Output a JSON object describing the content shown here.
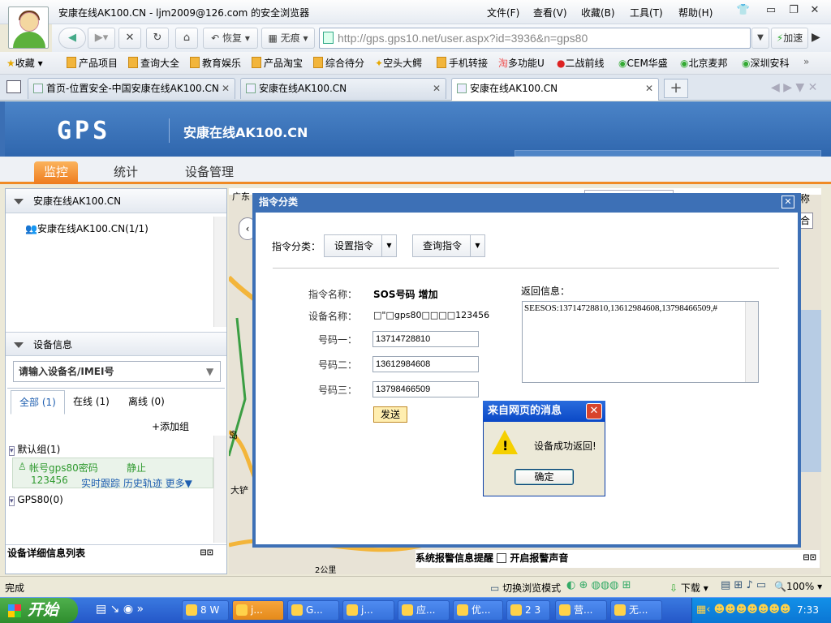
{
  "window": {
    "title": "安康在线AK100.CN - ljm2009@126.com 的安全浏览器",
    "menu": [
      "文件(F)",
      "查看(V)",
      "收藏(B)",
      "工具(T)",
      "帮助(H)"
    ]
  },
  "nav": {
    "restore_label": "恢复",
    "adblock_label": "无痕",
    "url": "http://gps.gps10.net/user.aspx?id=3936&n=gps80",
    "speed_label": "加速"
  },
  "favorites": [
    "收藏",
    "产品项目",
    "查询大全",
    "教育娱乐",
    "产品淘宝",
    "综合待分",
    "空头大鳄",
    "手机转接",
    "多功能U",
    "二战前线",
    "CEM华盛",
    "北京麦邦",
    "深圳安科"
  ],
  "tabs": [
    {
      "label": "首页-位置安全-中国安康在线AK100.CN"
    },
    {
      "label": "安康在线AK100.CN"
    },
    {
      "label": "安康在线AK100.CN"
    }
  ],
  "app": {
    "logo": "GPS",
    "site_name": "安康在线AK100.CN",
    "nav": [
      "监控",
      "统计",
      "设备管理"
    ]
  },
  "left": {
    "tree_header": "安康在线AK100.CN",
    "tree_item": "安康在线AK100.CN(1/1)",
    "device_header": "设备信息",
    "search_placeholder": "请输入设备名/IMEI号",
    "filters": [
      "全部 (1)",
      "在线 (1)",
      "离线 (0)"
    ],
    "add_group": "+添加组",
    "group_default": "默认组(1)",
    "device_line1": "帐号gps80密码",
    "device_status": "静止",
    "device_line2": "123456",
    "device_links": "实时跟踪 历史轨迹 更多▼",
    "group_gps80": "GPS80(0)",
    "detail_list": "设备详细信息列表"
  },
  "map": {
    "top_text": "广东",
    "right_label": "称",
    "right_box": "合",
    "left_label": "岛",
    "bottom_label": "大铲",
    "scale": "2公里",
    "alarm_info": "系统报警信息提醒",
    "alarm_sound": "开启报警声音"
  },
  "dialog": {
    "title": "指令分类",
    "category_label": "指令分类：",
    "set_cmd": "设置指令",
    "query_cmd": "查询指令",
    "cmd_name_label": "指令名称：",
    "cmd_name": "SOS号码 增加",
    "device_name_label": "设备名称：",
    "device_name": "□\"□gps80□□□□123456",
    "num1_label": "号码一：",
    "num1": "13714728810",
    "num2_label": "号码二：",
    "num2": "13612984608",
    "num3_label": "号码三：",
    "num3": "13798466509",
    "send_label": "发送",
    "return_label": "返回信息：",
    "return_text": "SEESOS:13714728810,13612984608,13798466509,#"
  },
  "msgbox": {
    "title": "来自网页的消息",
    "text": "设备成功返回!",
    "ok": "确定"
  },
  "status": {
    "left": "完成",
    "mode": "切换浏览模式",
    "download": "下载",
    "zoom": "100%"
  },
  "taskbar": {
    "start": "开始",
    "buttons": [
      "8 W",
      "j...",
      "G...",
      "j...",
      "应...",
      "优...",
      "2 3",
      "营...",
      "无..."
    ],
    "clock": "7:33"
  },
  "colors": {
    "accent": "#3d70b6",
    "nav_active": "#ee7b1d",
    "online_green": "#2f9a2f"
  }
}
